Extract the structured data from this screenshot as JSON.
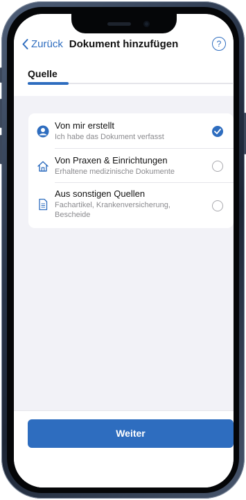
{
  "nav": {
    "back_label": "Zurück",
    "title": "Dokument hinzufügen",
    "help_label": "?"
  },
  "step": {
    "label": "Quelle",
    "progress": 0.2
  },
  "options": [
    {
      "title": "Von mir erstellt",
      "subtitle": "Ich habe das Dokument verfasst",
      "icon": "person-icon",
      "selected": true
    },
    {
      "title": "Von Praxen & Einrichtungen",
      "subtitle": "Erhaltene medizinische Dokumente",
      "icon": "house-icon",
      "selected": false
    },
    {
      "title": "Aus sonstigen Quellen",
      "subtitle": "Fachartikel, Krankenversicherung, Bescheide",
      "icon": "document-icon",
      "selected": false
    }
  ],
  "footer": {
    "next_label": "Weiter"
  },
  "colors": {
    "accent": "#2e6dbf",
    "background": "#f2f2f7"
  }
}
